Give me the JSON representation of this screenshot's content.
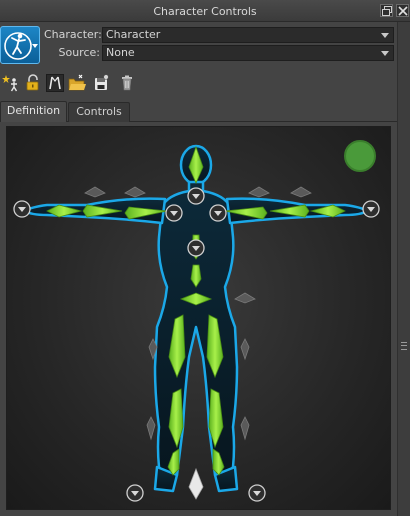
{
  "window": {
    "title": "Character Controls"
  },
  "header": {
    "character_label": "Character:",
    "character_value": "Character",
    "source_label": "Source:",
    "source_value": "None"
  },
  "toolbar": {
    "icons": [
      "add-character-icon",
      "lock-icon",
      "skeleton-icon",
      "open-folder-icon",
      "save-icon",
      "trash-icon"
    ]
  },
  "tabs": [
    {
      "label": "Definition",
      "active": true
    },
    {
      "label": "Controls",
      "active": false
    }
  ],
  "colors": {
    "accent_blue": "#1d86c6",
    "bone_green": "#8fe03c",
    "body_cyan": "#1ba8e8",
    "status_green": "#4a9a3a"
  }
}
